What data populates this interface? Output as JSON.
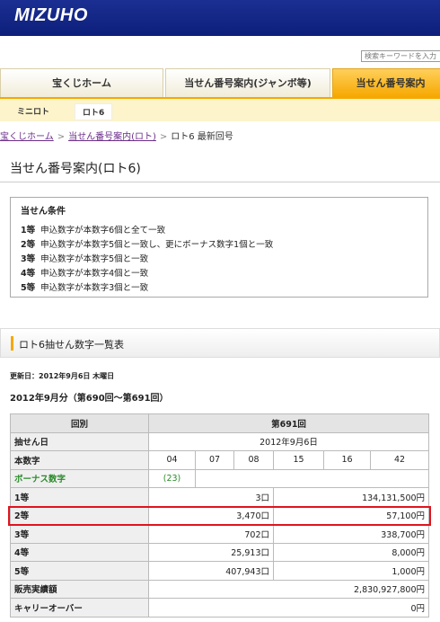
{
  "brand": {
    "logo_text": "MIZUHO"
  },
  "search": {
    "placeholder": "検索キーワードを入力"
  },
  "nav": {
    "tabs": [
      {
        "label": "宝くじホーム"
      },
      {
        "label": "当せん番号案内(ジャンボ等)"
      },
      {
        "label": "当せん番号案内"
      }
    ],
    "subtabs": [
      {
        "label": "ミニロト"
      },
      {
        "label": "ロト6"
      }
    ]
  },
  "breadcrumb": {
    "items": [
      "宝くじホーム",
      "当せん番号案内(ロト)",
      "ロト6 最新回号"
    ],
    "separator": ">"
  },
  "page_title": "当せん番号案内(ロト6)",
  "conditions": {
    "title": "当せん条件",
    "lines": [
      {
        "rank": "1等",
        "text": "申込数字が本数字6個と全て一致"
      },
      {
        "rank": "2等",
        "text": "申込数字が本数字5個と一致し、更にボーナス数字1個と一致"
      },
      {
        "rank": "3等",
        "text": "申込数字が本数字5個と一致"
      },
      {
        "rank": "4等",
        "text": "申込数字が本数字4個と一致"
      },
      {
        "rank": "5等",
        "text": "申込数字が本数字3個と一致"
      }
    ]
  },
  "section_title": "ロト6抽せん数字一覧表",
  "updated": "更新日：2012年9月6日 木曜日",
  "period": "2012年9月分（第690回～第691回）",
  "table": {
    "header_label": "回別",
    "header_value": "第691回",
    "draw_date_label": "抽せん日",
    "draw_date": "2012年9月6日",
    "main_numbers_label": "本数字",
    "main_numbers": [
      "04",
      "07",
      "08",
      "15",
      "16",
      "42"
    ],
    "bonus_label": "ボーナス数字",
    "bonus_number": "(23)",
    "prizes": [
      {
        "rank": "1等",
        "winners": "3口",
        "amount": "134,131,500円"
      },
      {
        "rank": "2等",
        "winners": "3,470口",
        "amount": "57,100円"
      },
      {
        "rank": "3等",
        "winners": "702口",
        "amount": "338,700円"
      },
      {
        "rank": "4等",
        "winners": "25,913口",
        "amount": "8,000円"
      },
      {
        "rank": "5等",
        "winners": "407,943口",
        "amount": "1,000円"
      }
    ],
    "sales_label": "販売実績額",
    "sales": "2,830,927,800円",
    "carryover_label": "キャリーオーバー",
    "carryover": "0円"
  },
  "highlight_color": "#e0141e",
  "accent_color": "#f6a800"
}
